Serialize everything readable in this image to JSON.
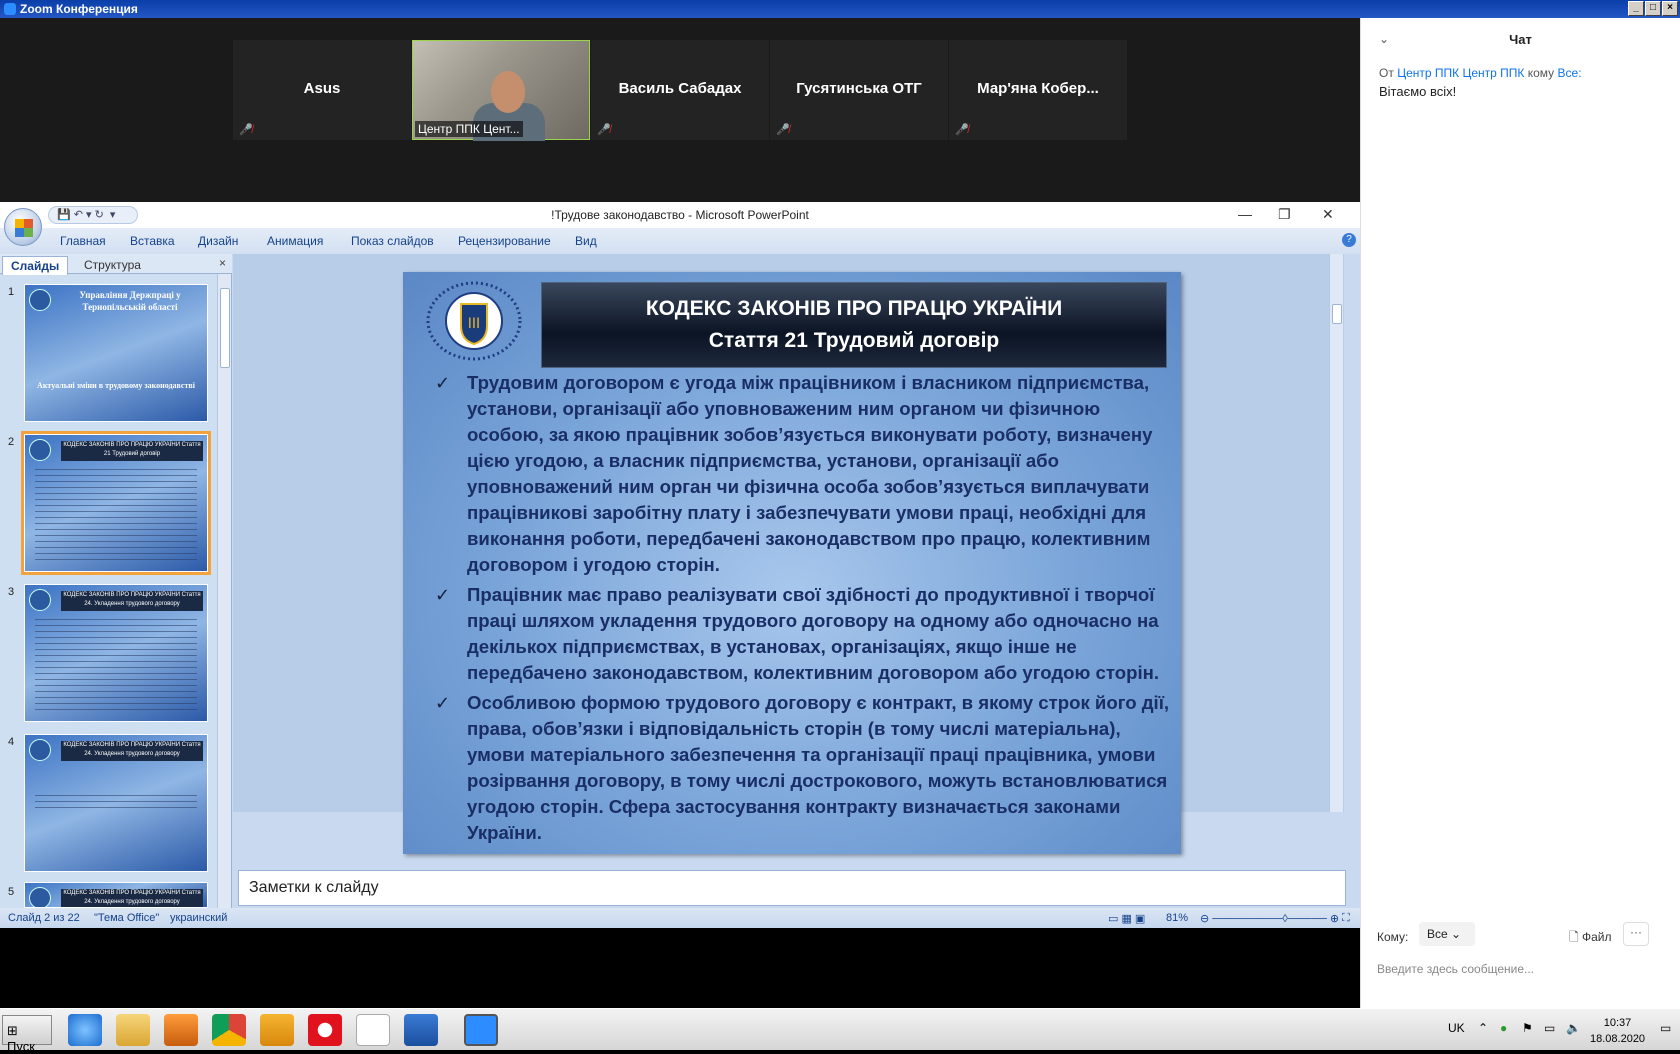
{
  "zoom": {
    "window_title": "Zoom Конференция",
    "participants": [
      {
        "name": "Asus"
      },
      {
        "name": "Центр ППК Цент..."
      },
      {
        "name": "Василь Сабадах"
      },
      {
        "name": "Гусятинська ОТГ"
      },
      {
        "name": "Мар'яна  Кобер..."
      }
    ]
  },
  "chat": {
    "title": "Чат",
    "message_from_prefix": "От",
    "message_from": "Центр ППК Центр ППК",
    "message_to_prefix": "кому",
    "message_to": "Все:",
    "message_text": "Вітаємо всіх!",
    "to_label": "Кому:",
    "to_value": "Все",
    "file_label": "Файл",
    "input_placeholder": "Введите здесь сообщение..."
  },
  "ppt": {
    "window_title": "!Трудове законодавство  -  Microsoft PowerPoint",
    "ribbon_tabs": [
      "Главная",
      "Вставка",
      "Дизайн",
      "Анимация",
      "Показ слайдов",
      "Рецензирование",
      "Вид"
    ],
    "pane_tabs": {
      "slides": "Слайды",
      "outline": "Структура"
    },
    "thumbnails": [
      {
        "num": "1",
        "title": "Управління Держпраці у Тернопільській області",
        "subtitle": "Актуальні зміни в трудовому законодавстві"
      },
      {
        "num": "2",
        "title": "КОДЕКС ЗАКОНІВ ПРО ПРАЦЮ УКРАЇНИ Стаття 21 Трудовий договір"
      },
      {
        "num": "3",
        "title": "КОДЕКС ЗАКОНІВ ПРО ПРАЦЮ УКРАЇНИ Стаття 24. Укладення трудового договору"
      },
      {
        "num": "4",
        "title": "КОДЕКС ЗАКОНІВ ПРО ПРАЦЮ УКРАЇНИ Стаття 24. Укладення трудового договору"
      },
      {
        "num": "5",
        "title": "КОДЕКС ЗАКОНІВ ПРО ПРАЦЮ УКРАЇНИ Стаття 24. Укладення трудового договору"
      }
    ],
    "slide": {
      "heading1": "КОДЕКС ЗАКОНІВ ПРО ПРАЦЮ УКРАЇНИ",
      "heading2": "Стаття 21 Трудовий договір",
      "bullets": [
        "Трудовим договором є угода між працівником і власником підприємства, установи, організації або уповноваженим ним органом чи фізичною особою, за якою працівник зобов’язується виконувати роботу, визначену цією угодою, а власник підприємства, установи, організації або уповноважений ним орган чи фізична особа зобов’язується виплачувати працівникові заробітну плату і забезпечувати умови праці, необхідні для виконання роботи, передбачені законодавством про працю, колективним договором і угодою сторін.",
        "Працівник має право реалізувати свої здібності до продуктивної і творчої праці шляхом укладення трудового договору на одному або одночасно на декількох підприємствах, в установах, організаціях, якщо інше не передбачено законодавством, колективним договором або угодою сторін.",
        "Особливою формою трудового договору є контракт, в якому строк його дії, права, обов’язки і відповідальність сторін (в тому числі матеріальна), умови матеріального забезпечення та організації праці працівника, умови розірвання договору, в тому числі дострокового, можуть встановлюватися угодою сторін. Сфера застосування контракту визначається законами України."
      ]
    },
    "notes_placeholder": "Заметки к слайду",
    "status": {
      "slide": "Слайд 2 из 22",
      "theme": "\"Тема Office\"",
      "language": "украинский",
      "zoom": "81%"
    }
  },
  "taskbar": {
    "start_label": "Пуск",
    "lang": "UK",
    "time": "10:37",
    "date": "18.08.2020"
  }
}
